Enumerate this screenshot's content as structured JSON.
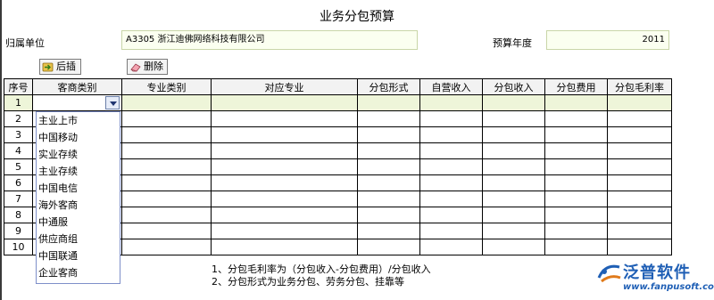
{
  "page": {
    "title": "业务分包预算"
  },
  "header": {
    "unit_label": "归属单位",
    "unit_value": "A3305    浙江迪佛网络科技有限公司",
    "year_label": "预算年度",
    "year_value": "2011"
  },
  "toolbar": {
    "insert_after_label": "后插",
    "delete_label": "删除"
  },
  "table": {
    "columns": [
      "序号",
      "客商类别",
      "专业类别",
      "对应专业",
      "分包形式",
      "自营收入",
      "分包收入",
      "分包费用",
      "分包毛利率"
    ],
    "rows": [
      "1",
      "2",
      "3",
      "4",
      "5",
      "6",
      "7",
      "8",
      "9",
      "10"
    ]
  },
  "dropdown": {
    "options": [
      "主业上市",
      "中国移动",
      "实业存续",
      "主业存续",
      "中国电信",
      "海外客商",
      "中通服",
      "供应商组",
      "中国联通",
      "企业客商"
    ]
  },
  "notes": [
    "1、分包毛利率为（分包收入-分包费用）/分包收入",
    "2、分包形式为业务分包、劳务分包、挂靠等"
  ],
  "logo": {
    "name": "泛普软件",
    "url": "www.fanpusoft.com"
  }
}
